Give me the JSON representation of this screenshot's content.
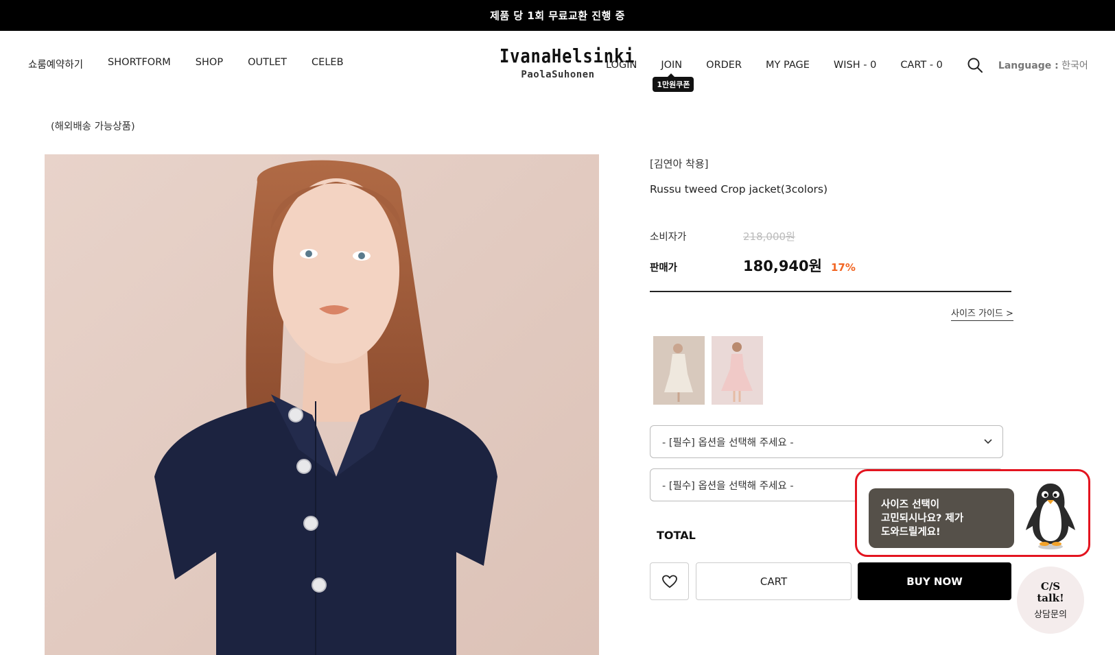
{
  "announcement": "제품 당 1회 무료교환 진행 중",
  "nav_left": [
    "쇼룸예약하기",
    "SHORTFORM",
    "SHOP",
    "OUTLET",
    "CELEB"
  ],
  "logo": {
    "main": "IvanaHelsinki",
    "sub": "PaolaSuhonen"
  },
  "nav_right": {
    "login": "LOGIN",
    "join": "JOIN",
    "join_badge": "1만원쿠폰",
    "order": "ORDER",
    "mypage": "MY PAGE",
    "wish": "WISH - 0",
    "cart": "CART - 0",
    "language_label": "Language :",
    "language_value": " 한국어"
  },
  "overseas_note": "(해외배송 가능상품)",
  "product": {
    "tag": "[김연아 착용]",
    "name": "Russu tweed Crop jacket(3colors)",
    "consumer_price_label": "소비자가",
    "consumer_price": "218,000원",
    "sale_price_label": "판매가",
    "sale_price": "180,940원",
    "discount": "17%",
    "size_guide": "사이즈 가이드 >"
  },
  "options": {
    "select1": "- [필수] 옵션을 선택해 주세요 -",
    "select2": "- [필수] 옵션을 선택해 주세요 -"
  },
  "total_label": "TOTAL",
  "buttons": {
    "cart": "CART",
    "buy_now": "BUY NOW"
  },
  "size_helper": {
    "line1": "사이즈 선택이",
    "line2": "고민되시나요? 제가",
    "line3": "도와드릴게요!"
  },
  "cs_talk": {
    "title_line1": "C/S",
    "title_line2": "talk!",
    "label": "상담문의"
  },
  "colors": {
    "discount": "#f26522",
    "highlight": "#e3141f",
    "topbar": "#000000",
    "bubble": "#555049"
  }
}
